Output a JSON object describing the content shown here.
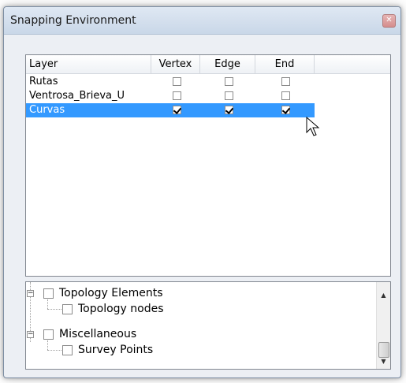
{
  "window": {
    "title": "Snapping Environment",
    "close_label": "✕"
  },
  "grid": {
    "columns": [
      "Layer",
      "Vertex",
      "Edge",
      "End"
    ],
    "rows": [
      {
        "name": "Rutas",
        "vertex": false,
        "edge": false,
        "end": false,
        "selected": false
      },
      {
        "name": "Ventrosa_Brieva_U",
        "vertex": false,
        "edge": false,
        "end": false,
        "selected": false
      },
      {
        "name": "Curvas",
        "vertex": true,
        "edge": true,
        "end": true,
        "selected": true
      }
    ]
  },
  "tree": {
    "items": [
      {
        "label": "Topology Elements",
        "level": 0,
        "expander": "−"
      },
      {
        "label": "Topology nodes",
        "level": 1
      },
      {
        "label": "Miscellaneous",
        "level": 0,
        "expander": "−"
      },
      {
        "label": "Survey Points",
        "level": 1
      }
    ],
    "scroll_up": "▲",
    "scroll_down": "▼"
  }
}
